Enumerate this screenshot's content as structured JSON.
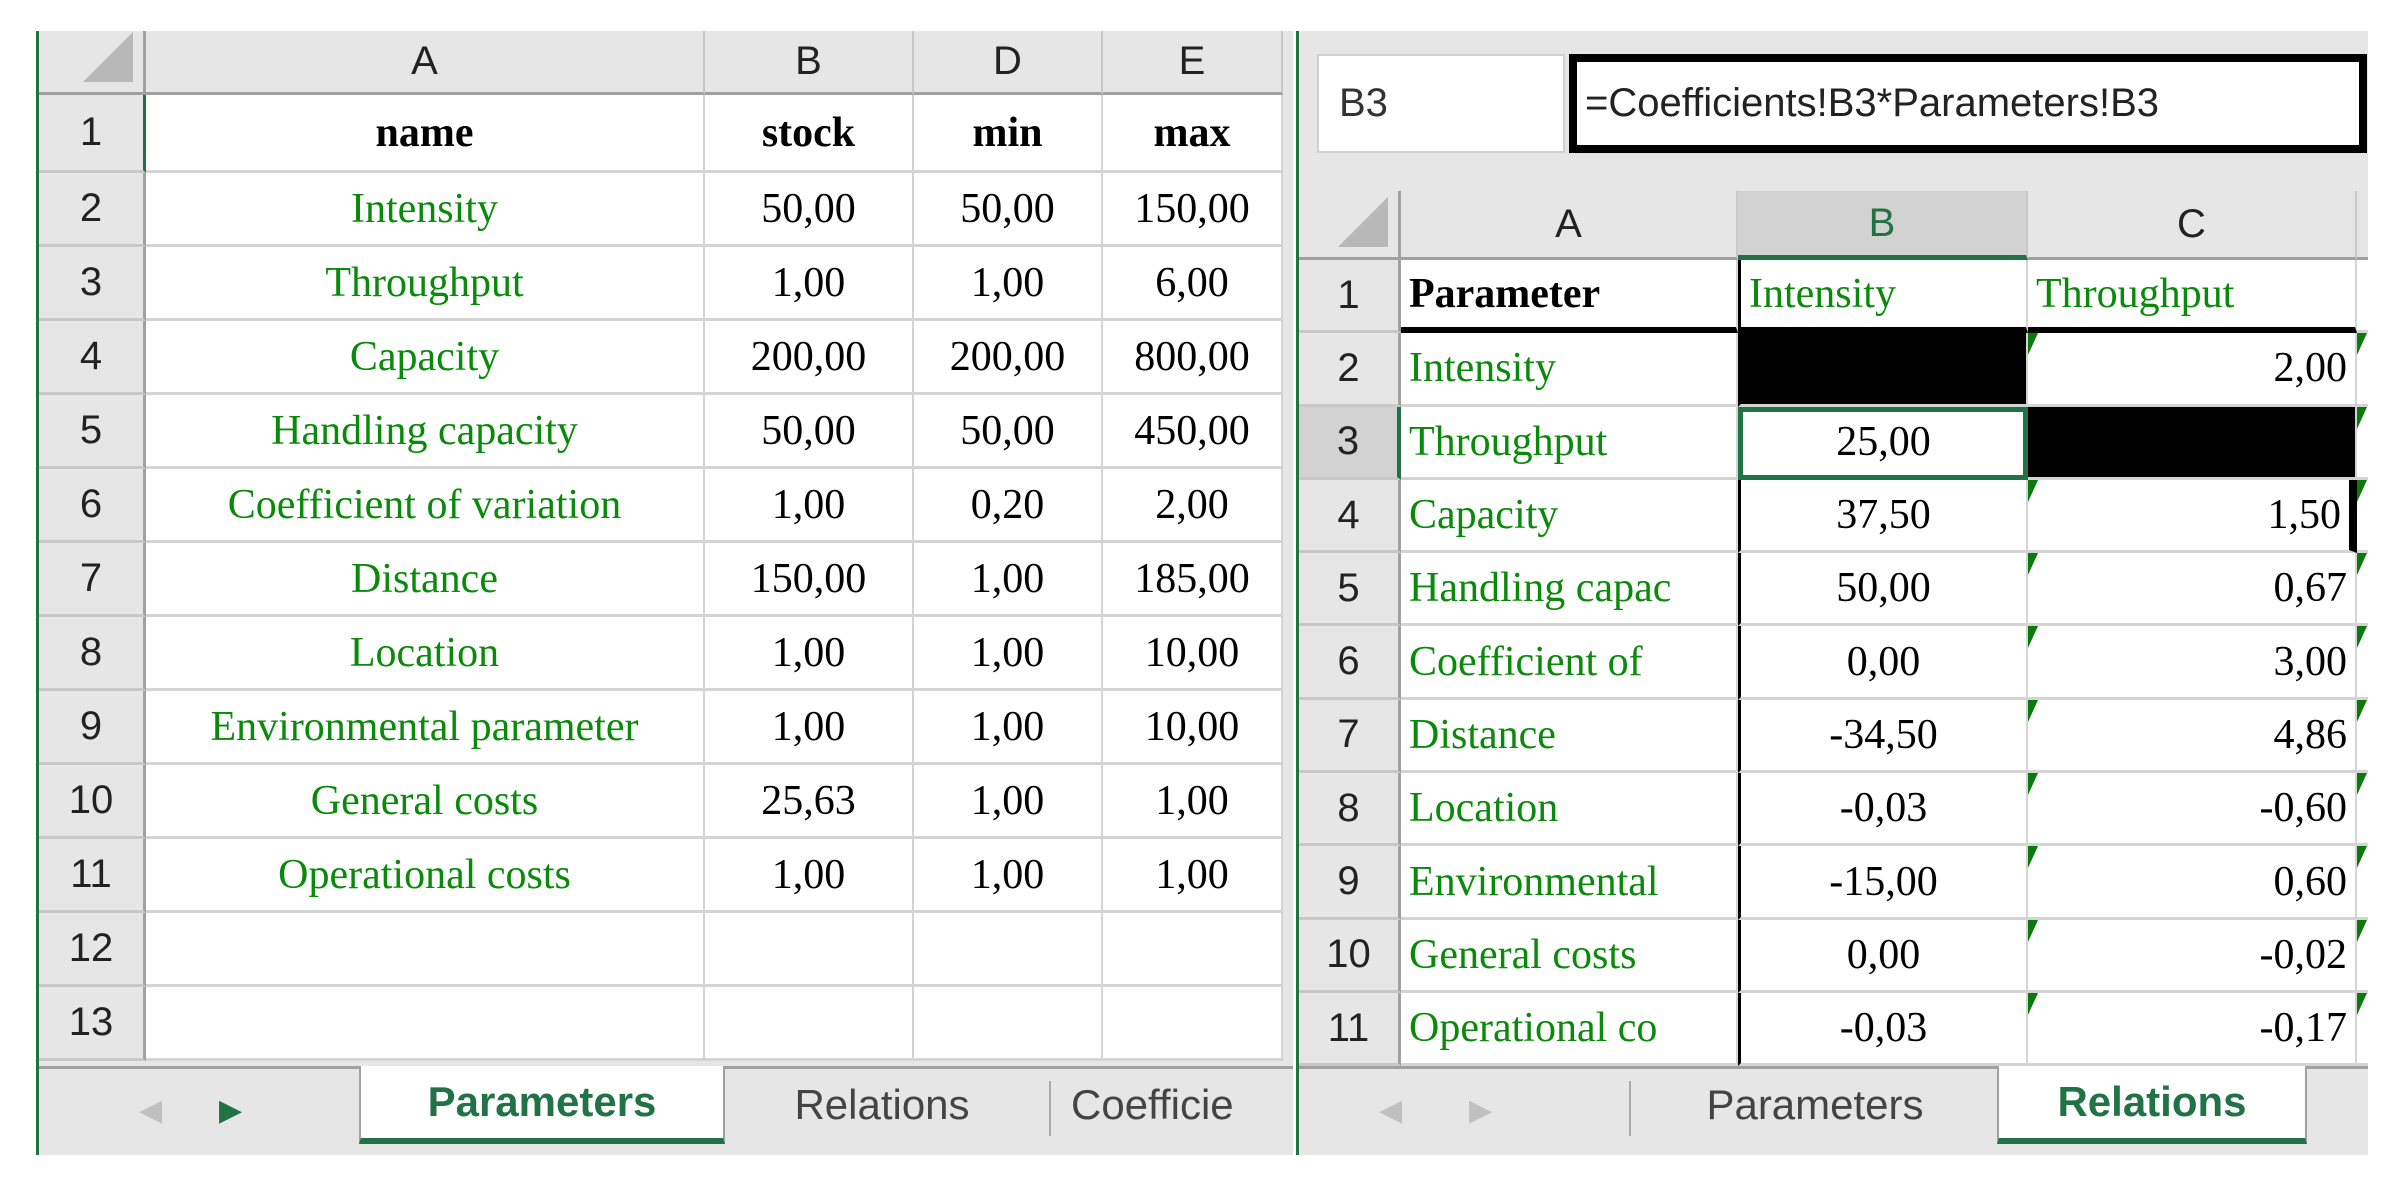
{
  "left_sheet": {
    "columns": [
      "A",
      "B",
      "D",
      "E"
    ],
    "row_numbers": [
      "1",
      "2",
      "3",
      "4",
      "5",
      "6",
      "7",
      "8",
      "9",
      "10",
      "11",
      "12",
      "13"
    ],
    "header": {
      "name": "name",
      "stock": "stock",
      "min": "min",
      "max": "max"
    },
    "rows": [
      {
        "name": "Intensity",
        "stock": "50,00",
        "min": "50,00",
        "max": "150,00"
      },
      {
        "name": "Throughput",
        "stock": "1,00",
        "min": "1,00",
        "max": "6,00"
      },
      {
        "name": "Capacity",
        "stock": "200,00",
        "min": "200,00",
        "max": "800,00"
      },
      {
        "name": "Handling capacity",
        "stock": "50,00",
        "min": "50,00",
        "max": "450,00"
      },
      {
        "name": "Coefficient of variation",
        "stock": "1,00",
        "min": "0,20",
        "max": "2,00"
      },
      {
        "name": "Distance",
        "stock": "150,00",
        "min": "1,00",
        "max": "185,00"
      },
      {
        "name": "Location",
        "stock": "1,00",
        "min": "1,00",
        "max": "10,00"
      },
      {
        "name": "Environmental parameter",
        "stock": "1,00",
        "min": "1,00",
        "max": "10,00"
      },
      {
        "name": "General costs",
        "stock": "25,63",
        "min": "1,00",
        "max": "1,00"
      },
      {
        "name": "Operational costs",
        "stock": "1,00",
        "min": "1,00",
        "max": "1,00"
      }
    ],
    "tabs": [
      "Parameters",
      "Relations",
      "Coefficie"
    ],
    "active_tab": "Parameters"
  },
  "right_sheet": {
    "name_box": "B3",
    "formula": "=Coefficients!B3*Parameters!B3",
    "columns": [
      "A",
      "B",
      "C"
    ],
    "row_numbers": [
      "1",
      "2",
      "3",
      "4",
      "5",
      "6",
      "7",
      "8",
      "9",
      "10",
      "11"
    ],
    "header": {
      "a": "Parameter",
      "b": "Intensity",
      "c": "Throughput"
    },
    "rows": [
      {
        "a": "Intensity",
        "b": "",
        "c": "2,00"
      },
      {
        "a": "Throughput",
        "b": "25,00",
        "c": ""
      },
      {
        "a": "Capacity",
        "b": "37,50",
        "c": "1,50"
      },
      {
        "a": "Handling capac",
        "b": "50,00",
        "c": "0,67"
      },
      {
        "a": "Coefficient of",
        "b": "0,00",
        "c": "3,00"
      },
      {
        "a": "Distance",
        "b": "-34,50",
        "c": "4,86"
      },
      {
        "a": "Location",
        "b": "-0,03",
        "c": "-0,60"
      },
      {
        "a": "Environmental",
        "b": "-15,00",
        "c": "0,60"
      },
      {
        "a": "General costs",
        "b": "0,00",
        "c": "-0,02"
      },
      {
        "a": "Operational co",
        "b": "-0,03",
        "c": "-0,17"
      }
    ],
    "tabs": [
      "Parameters",
      "Relations"
    ],
    "active_tab": "Relations"
  },
  "colors": {
    "accent": "#217346",
    "text_green": "#0a8a0a"
  }
}
